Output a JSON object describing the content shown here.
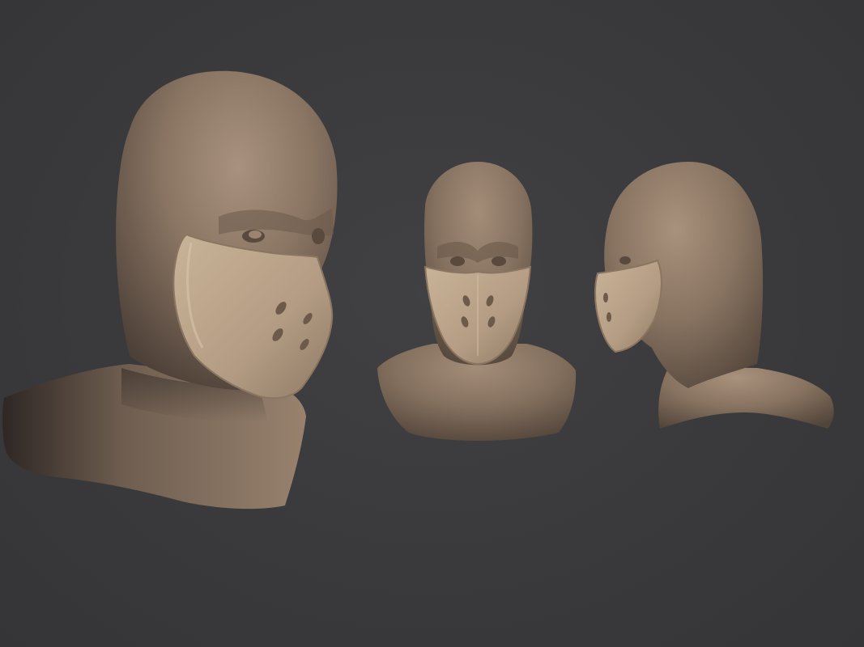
{
  "scene": {
    "background_color": "#3a3a3c",
    "clay_color": "#7d6a5a",
    "clay_highlight": "#a8927e",
    "mask_color": "#b59f86",
    "mask_highlight": "#cdb89e",
    "views": [
      {
        "id": "three-quarter",
        "label": ""
      },
      {
        "id": "front",
        "label": ""
      },
      {
        "id": "side",
        "label": ""
      }
    ]
  }
}
